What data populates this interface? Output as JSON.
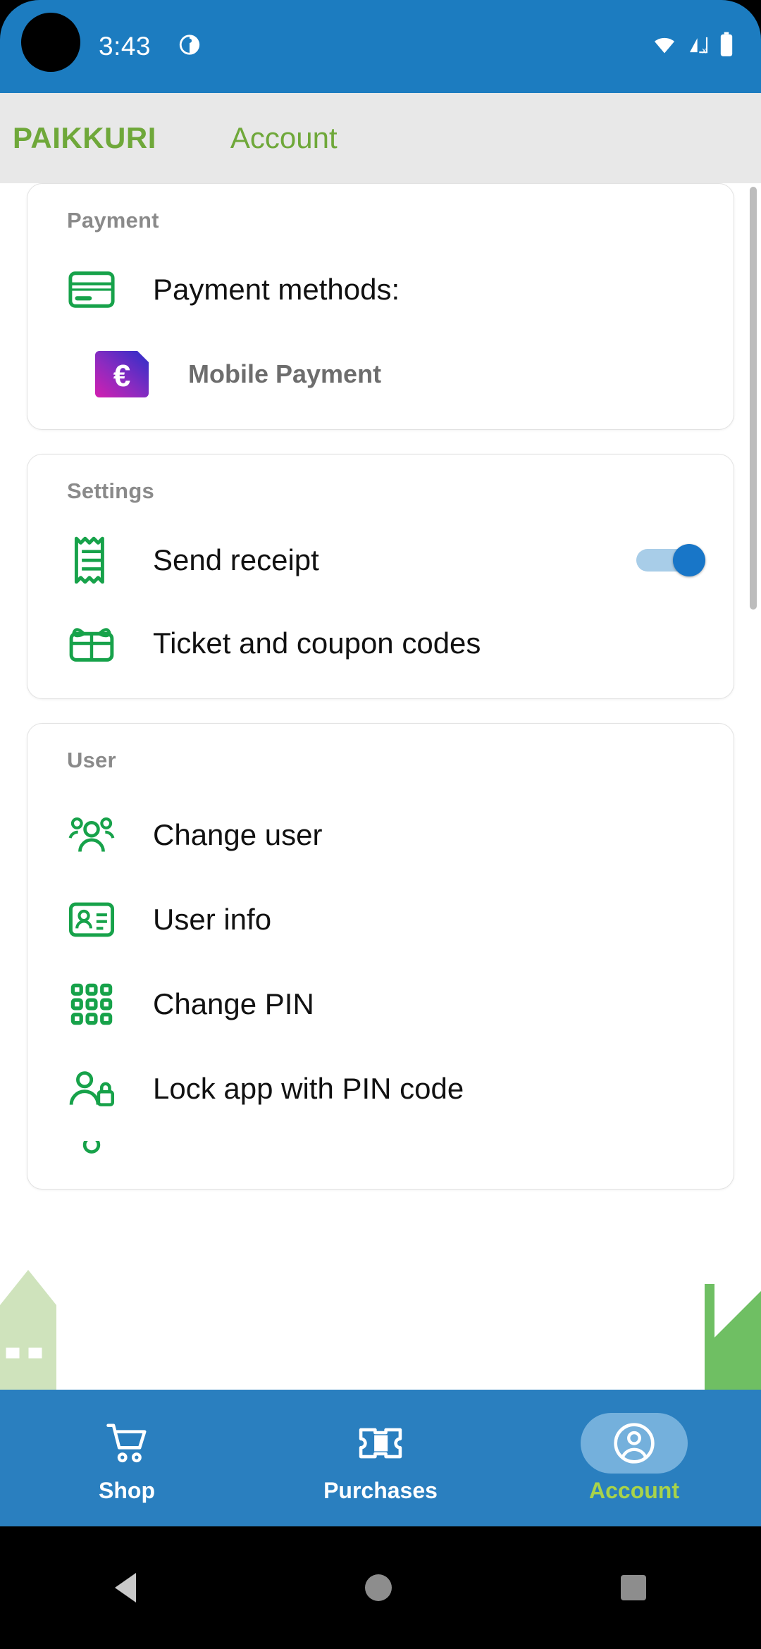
{
  "theme": {
    "status_bar_bg": "#1c7cc0",
    "appbar_bg": "#e8e8e8",
    "brand_green": "#6fa83a",
    "icon_green": "#17a24a",
    "nav_bg": "#2a7fbf",
    "nav_active_pill": "#74b0dc",
    "nav_active_label": "#a8d34a",
    "toggle_on": "#1876c8"
  },
  "status_bar": {
    "time": "3:43",
    "notification_icon": "app-notification-icon",
    "wifi_icon": "wifi-icon",
    "cellular_icon": "cellular-no-sim-icon",
    "battery_icon": "battery-full-icon"
  },
  "header": {
    "brand": "PAIKKURI",
    "title": "Account"
  },
  "cards": [
    {
      "id": "payment",
      "title": "Payment",
      "rows": [
        {
          "id": "payment-methods",
          "icon": "credit-card-icon",
          "label": "Payment methods:",
          "style": "normal"
        },
        {
          "id": "mobile-payment",
          "icon": "euro-badge-icon",
          "label": "Mobile Payment",
          "style": "muted"
        }
      ]
    },
    {
      "id": "settings",
      "title": "Settings",
      "rows": [
        {
          "id": "send-receipt",
          "icon": "receipt-icon",
          "label": "Send receipt",
          "style": "normal",
          "toggle": "on"
        },
        {
          "id": "ticket-coupon-codes",
          "icon": "gift-card-icon",
          "label": "Ticket and coupon codes",
          "style": "normal"
        }
      ]
    },
    {
      "id": "user",
      "title": "User",
      "rows": [
        {
          "id": "change-user",
          "icon": "people-icon",
          "label": "Change user",
          "style": "normal"
        },
        {
          "id": "user-info",
          "icon": "id-card-icon",
          "label": "User info",
          "style": "normal"
        },
        {
          "id": "change-pin",
          "icon": "keypad-icon",
          "label": "Change PIN",
          "style": "normal"
        },
        {
          "id": "lock-app-pin",
          "icon": "person-lock-icon",
          "label": "Lock app with PIN code",
          "style": "normal"
        }
      ]
    }
  ],
  "bottom_nav": {
    "items": [
      {
        "id": "shop",
        "icon": "shopping-cart-icon",
        "label": "Shop",
        "active": false
      },
      {
        "id": "purchases",
        "icon": "ticket-icon",
        "label": "Purchases",
        "active": false
      },
      {
        "id": "account",
        "icon": "account-circle-icon",
        "label": "Account",
        "active": true
      }
    ]
  },
  "system_nav": {
    "back": "back-triangle-icon",
    "home": "home-circle-icon",
    "recents": "recents-square-icon"
  }
}
